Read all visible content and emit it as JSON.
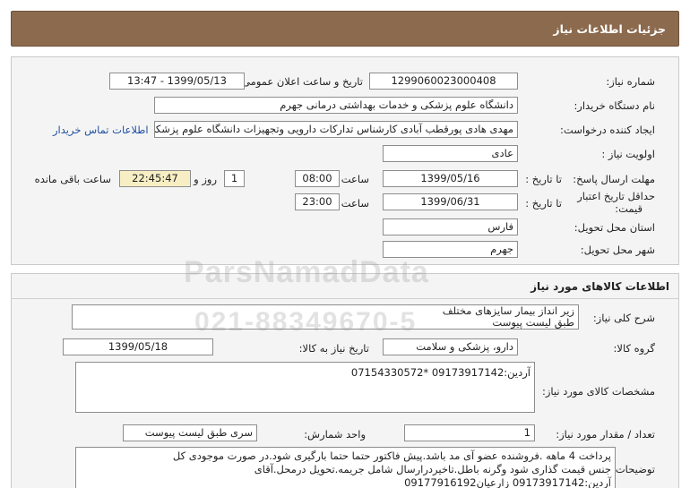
{
  "header": {
    "title": "جزئیات اطلاعات نیاز"
  },
  "need_info": {
    "need_number_label": "شماره نیاز:",
    "need_number": "1299060023000408",
    "announce_label": "تاریخ و ساعت اعلان عمومی:",
    "announce_value": "1399/05/13 - 13:47",
    "buyer_org_label": "نام دستگاه خریدار:",
    "buyer_org": "دانشگاه علوم پزشکی و خدمات بهداشتی درمانی جهرم",
    "requester_label": "ایجاد کننده درخواست:",
    "requester": "مهدی هادی پورقطب آبادی کارشناس تدارکات دارویی وتجهیزات دانشگاه علوم پزشکی",
    "contact_link": "اطلاعات تماس خریدار",
    "priority_label": "اولویت نیاز :",
    "priority": "عادی",
    "reply_deadline_label": "مهلت ارسال پاسخ:",
    "to_date_label": "تا تاریخ :",
    "reply_date": "1399/05/16",
    "time_label": "ساعت",
    "reply_time": "08:00",
    "days_count": "1",
    "days_label": "روز و",
    "remaining_time": "22:45:47",
    "remaining_label": "ساعت باقی مانده",
    "price_validity_label_1": "حداقل تاریخ اعتبار",
    "price_validity_label_2": "قیمت:",
    "price_validity_date": "1399/06/31",
    "price_validity_time": "23:00",
    "province_label": "استان محل تحویل:",
    "province": "فارس",
    "city_label": "شهر محل تحویل:",
    "city": "جهرم"
  },
  "goods_info": {
    "section_title": "اطلاعات کالاهای مورد نیاز",
    "description_label": "شرح کلی نیاز:",
    "description_lines": [
      "زیر انداز بیمار سایزهای مختلف",
      "طبق لیست پیوست"
    ],
    "group_label": "گروه کالا:",
    "group": "دارو، پزشکی و سلامت",
    "need_date_label": "تاریخ نیاز به کالا:",
    "need_date": "1399/05/18",
    "specs_label": "مشخصات کالای مورد نیاز:",
    "specs": "آردین:09173917142 *07154330572",
    "quantity_label": "تعداد / مقدار مورد نیاز:",
    "quantity": "1",
    "unit_label": "واحد شمارش:",
    "unit": "سری طبق لیست پیوست",
    "buyer_notes_label": "توضیحات خریدار:",
    "buyer_notes_lines": [
      "پرداخت 4 ماهه .فروشنده عضو آی مد باشد.پیش فاکتور حتما حتما بارگیری شود.در صورت موجودی کل",
      "جنس قیمت گذاری شود وگرنه باطل.تاخیردرارسال شامل جریمه.تحویل درمحل.آقای",
      "آردین:09173917142 زارعیان09177916192"
    ]
  },
  "watermark": {
    "line1": "ParsNamadData",
    "line2": "021-88349670-5"
  }
}
